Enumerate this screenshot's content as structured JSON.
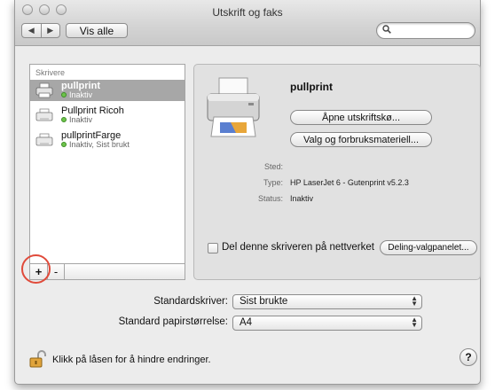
{
  "window": {
    "title": "Utskrift og faks"
  },
  "toolbar": {
    "back_label": "◀",
    "forward_label": "▶",
    "show_all_label": "Vis alle",
    "search_value": ""
  },
  "printers": {
    "header": "Skrivere",
    "items": [
      {
        "name": "pullprint",
        "status": "Inaktiv",
        "selected": true
      },
      {
        "name": "Pullprint Ricoh",
        "status": "Inaktiv",
        "selected": false
      },
      {
        "name": "pullprintFarge",
        "status": "Inaktiv, Sist brukt",
        "selected": false
      }
    ],
    "add_label": "+",
    "remove_label": "-"
  },
  "detail": {
    "name": "pullprint",
    "open_queue_label": "Åpne utskriftskø...",
    "options_label": "Valg og forbruksmateriell...",
    "location_label": "Sted:",
    "location_value": "",
    "type_label": "Type:",
    "type_value": "HP LaserJet 6 - Gutenprint v5.2.3",
    "status_label": "Status:",
    "status_value": "Inaktiv",
    "share_label": "Del denne skriveren på nettverket",
    "share_checked": false,
    "sharing_prefs_label": "Deling-valgpanelet..."
  },
  "defaults": {
    "printer_label": "Standardskriver:",
    "printer_value": "Sist brukte",
    "paper_label": "Standard papirstørrelse:",
    "paper_value": "A4"
  },
  "footer": {
    "lock_text": "Klikk på låsen for å hindre endringer.",
    "help_label": "?"
  },
  "colors": {
    "selection": "#a7a7a7",
    "status_dot": "#6ec34b",
    "highlight_circle": "#e04a3a"
  }
}
